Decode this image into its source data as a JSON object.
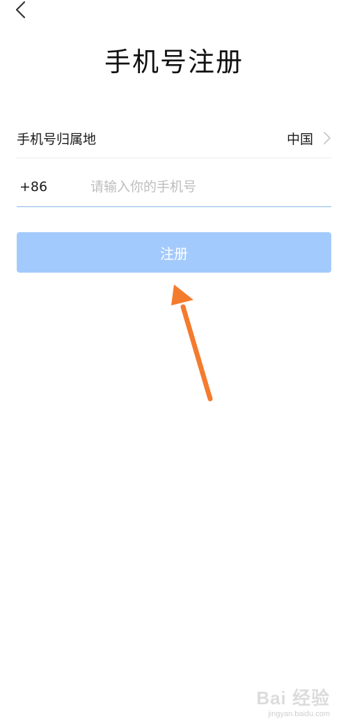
{
  "header": {
    "back_icon": "chevron-left-icon",
    "title": "手机号注册"
  },
  "form": {
    "region_label": "手机号归属地",
    "region_value": "中国",
    "region_chevron_icon": "chevron-right-icon",
    "country_code": "+86",
    "phone_value": "",
    "phone_placeholder": "请输入你的手机号",
    "input_underline_color": "#8ab8e6"
  },
  "actions": {
    "register_label": "注册",
    "register_bg_color": "#a3cafd"
  },
  "annotation": {
    "arrow_color": "#f47b2e"
  },
  "watermark": {
    "logo": "Bai 经验",
    "url": "jingyan.baidu.com"
  }
}
